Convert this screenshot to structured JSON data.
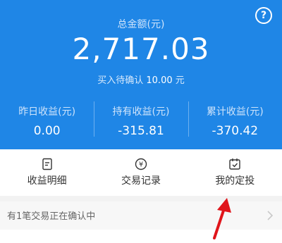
{
  "header": {
    "total_label": "总金额(元)",
    "total_value": "2,717.03",
    "pending_label": "买入待确认",
    "pending_amount": "10.00",
    "pending_unit": "元",
    "help_icon": "?"
  },
  "stats": [
    {
      "label": "昨日收益(元)",
      "value": "0.00"
    },
    {
      "label": "持有收益(元)",
      "value": "-315.81"
    },
    {
      "label": "累计收益(元)",
      "value": "-370.42"
    }
  ],
  "actions": [
    {
      "label": "收益明细",
      "icon": "document-icon"
    },
    {
      "label": "交易记录",
      "icon": "yen-coin-icon"
    },
    {
      "label": "我的定投",
      "icon": "calendar-check-icon"
    }
  ],
  "notice": {
    "text": "有1笔交易正在确认中"
  },
  "colors": {
    "header_bg": "#1f86e6",
    "arrow": "#e0151b"
  }
}
